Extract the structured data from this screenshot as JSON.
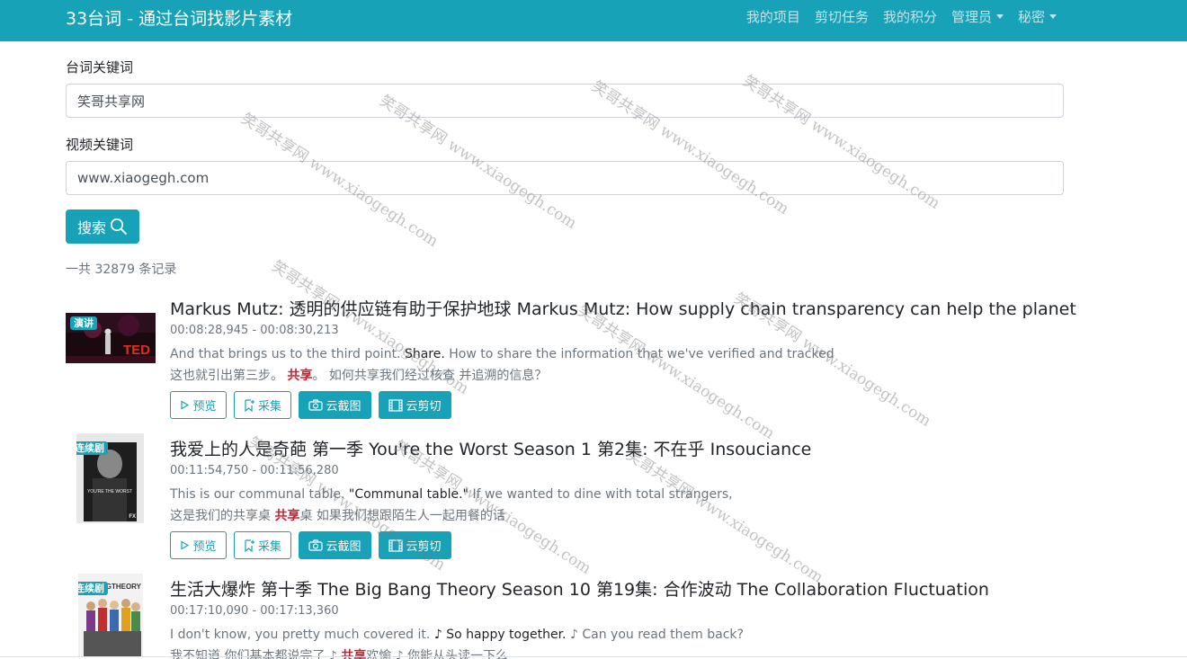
{
  "navbar": {
    "brand": "33台词 - 通过台词找影片素材",
    "items": [
      "我的项目",
      "剪切任务",
      "我的积分",
      "管理员",
      "秘密"
    ]
  },
  "form": {
    "line_label": "台词关键词",
    "line_value": "笑哥共享网",
    "video_label": "视频关键词",
    "video_value": "www.xiaogegh.com",
    "search_label": "搜索"
  },
  "results": {
    "count_text": "一共 32879 条记录",
    "buttons": {
      "preview": "预览",
      "collect": "采集",
      "screenshot": "云截图",
      "cut": "云剪切"
    },
    "items": [
      {
        "badge": "演讲",
        "title": "Markus Mutz: 透明的供应链有助于保护地球 Markus Mutz: How supply chain transparency can help the planet",
        "time": "00:08:28,945 - 00:08:30,213",
        "en_before": "And that brings us to the third point.",
        "en_match": "Share.",
        "en_after": "How to share the information that we've verified and tracked",
        "zh_before": "这也就引出第三步。",
        "zh_match": "共享",
        "zh_after": "。 如何共享我们经过核查 并追溯的信息？"
      },
      {
        "badge": "连续剧",
        "title": "我爱上的人是奇葩 第一季 You're the Worst Season 1 第2集: 不在乎 Insouciance",
        "time": "00:11:54,750 - 00:11:56,280",
        "en_before": "This is our communal table.",
        "en_match": "\"Communal table.\"",
        "en_after": "If we wanted to dine with total strangers,",
        "zh_before": "这是我们的共享桌",
        "zh_match": "共享",
        "zh_after": "桌 如果我们想跟陌生人一起用餐的话"
      },
      {
        "badge": "连续剧",
        "title": "生活大爆炸 第十季 The Big Bang Theory Season 10 第19集: 合作波动 The Collaboration Fluctuation",
        "time": "00:17:10,090 - 00:17:13,360",
        "en_before": "I don't know, you pretty much covered it.",
        "en_match": "♪ So happy together.",
        "en_after": "♪ Can you read them back?",
        "zh_before": "我不知道 你们基本都说完了 ♪",
        "zh_match": "共享",
        "zh_after": "欢愉 ♪ 你能从头读一下么"
      }
    ]
  },
  "thumb_texts": [
    "TED",
    "YOU'RE THE WORST",
    "FX",
    "GTHEORY"
  ],
  "watermark": "笑哥共享网 www.xiaogegh.com",
  "colors": {
    "primary": "#17a2b8",
    "highlight": "#c82333"
  }
}
